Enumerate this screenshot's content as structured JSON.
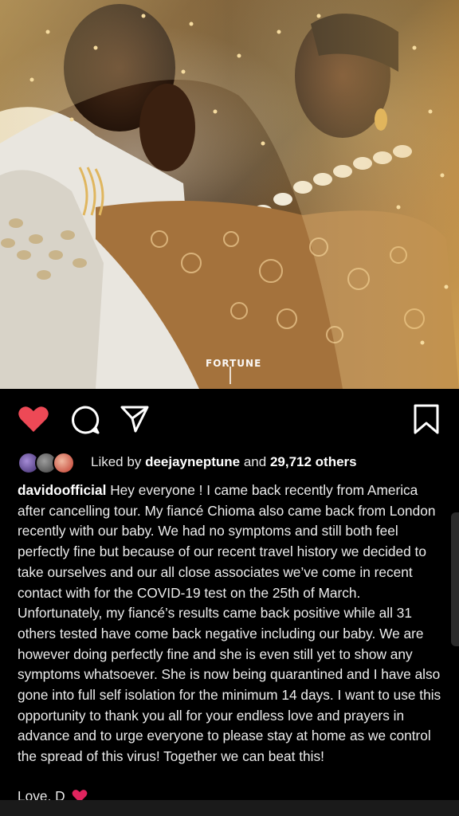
{
  "post": {
    "image": {
      "alt_icon": "wedding-photo",
      "watermark": "FORTUNE"
    },
    "actions": {
      "like_icon": "heart-filled-icon",
      "like_color": "#ed4956",
      "comment_icon": "comment-icon",
      "share_icon": "send-icon",
      "save_icon": "bookmark-icon"
    },
    "likes": {
      "prefix": "Liked by",
      "user": "deejayneptune",
      "conjunction": "and",
      "others": "29,712 others"
    },
    "caption": {
      "username": "davidoofficial",
      "text": "Hey everyone ! I came back recently from America after cancelling tour. My fiancé Chioma also came back from London recently with our baby. We had no symptoms and still both feel perfectly fine but because of our recent travel history we decided to take ourselves and our all close associates we’ve come in recent contact with for the COVID-19 test on the 25th of March. Unfortunately, my fiancé’s results came back positive while all 31 others tested have come back negative including our baby. We are however doing perfectly fine and she is even still yet to show any symptoms whatsoever. She is now being quarantined and I have also gone into full self isolation for the minimum 14 days. I want to use this opportunity to thank you all for your endless love and prayers in advance and to urge everyone to please stay at home as we control the spread of this virus! Together we can beat this!",
      "signoff": "Love, D"
    }
  }
}
